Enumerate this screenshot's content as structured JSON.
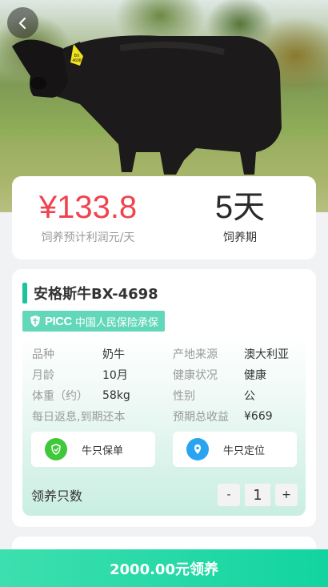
{
  "profit": {
    "value": "¥133.8",
    "label": "饲养预计利润元/天"
  },
  "period": {
    "value": "5天",
    "label": "饲养期"
  },
  "cattle": {
    "name": "安格斯牛BX-4698",
    "ear_tag_text": "BX 4698",
    "insurer_logo": "PICC",
    "insurer_text": "中国人民保险承保"
  },
  "info": {
    "breed_label": "品种",
    "breed_value": "奶牛",
    "origin_label": "产地来源",
    "origin_value": "澳大利亚",
    "age_label": "月龄",
    "age_value": "10月",
    "health_label": "健康状况",
    "health_value": "健康",
    "weight_label": "体重（约）",
    "weight_value": "58kg",
    "sex_label": "性别",
    "sex_value": "公",
    "return_text": "每日返息,到期还本",
    "total_label": "预期总收益",
    "total_value": "¥669"
  },
  "actions": {
    "policy_label": "牛只保单",
    "locate_label": "牛只定位"
  },
  "quantity": {
    "label": "领养只数",
    "minus": "-",
    "value": "1",
    "plus": "+"
  },
  "adopt": {
    "label": "2000.00元领养"
  },
  "colors": {
    "accent": "#1bc49c",
    "price": "#f0434e",
    "badge": "#62d7b9"
  }
}
